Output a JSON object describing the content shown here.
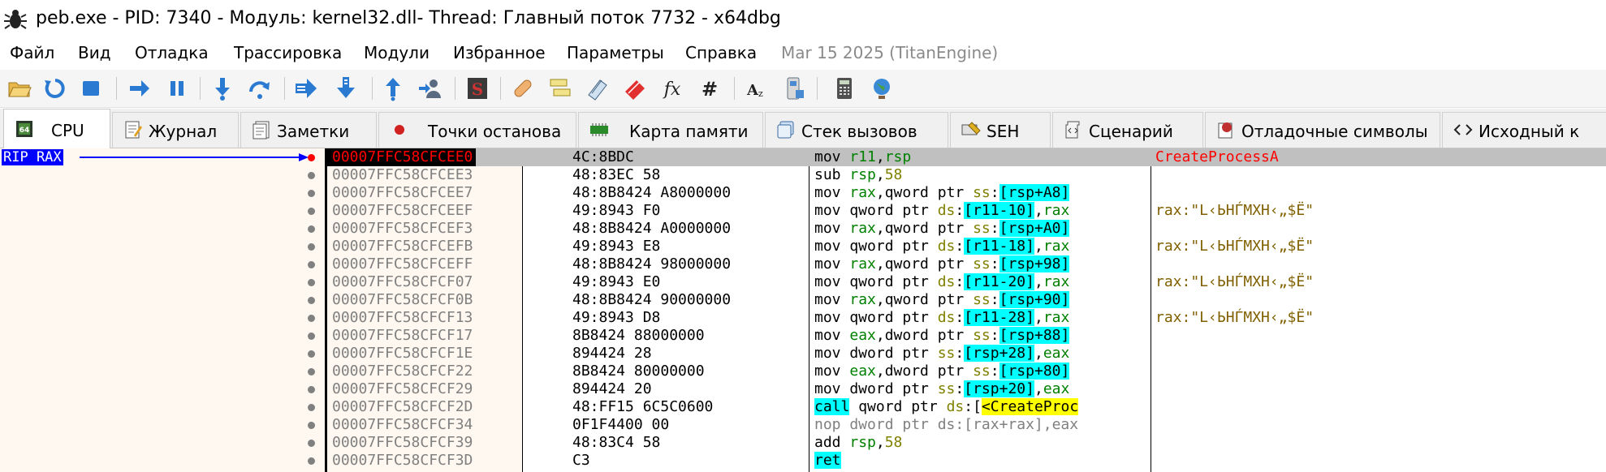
{
  "window": {
    "title": "peb.exe - PID: 7340 - Модуль: kernel32.dll- Thread: Главный поток 7732 - x64dbg"
  },
  "menu": {
    "items": [
      "Файл",
      "Вид",
      "Отладка",
      "Трассировка",
      "Модули",
      "Избранное",
      "Параметры",
      "Справка"
    ],
    "build_date": "Mar 15 2025 (TitanEngine)"
  },
  "toolbar": {
    "buttons": [
      "open-icon",
      "restart-icon",
      "stop-icon",
      "run-icon",
      "pause-icon",
      "step-into-icon",
      "step-over-icon",
      "trace-into-icon",
      "trace-over-icon",
      "execute-till-return-icon",
      "run-to-user-code-icon",
      "scylla-icon",
      "patch-icon",
      "comments-icon",
      "labels-icon",
      "bookmarks-icon",
      "functions-icon",
      "hash-icon",
      "strings-icon",
      "calculator-icon",
      "memory-icon",
      "globe-icon"
    ]
  },
  "tabs": [
    {
      "label": "CPU",
      "icon": "cpu-icon",
      "active": true
    },
    {
      "label": "Журнал",
      "icon": "log-icon"
    },
    {
      "label": "Заметки",
      "icon": "notes-icon"
    },
    {
      "label": "Точки останова",
      "icon": "breakpoint-icon"
    },
    {
      "label": "Карта памяти",
      "icon": "memory-map-icon"
    },
    {
      "label": "Стек вызовов",
      "icon": "call-stack-icon"
    },
    {
      "label": "SEH",
      "icon": "seh-icon"
    },
    {
      "label": "Сценарий",
      "icon": "script-icon"
    },
    {
      "label": "Отладочные символы",
      "icon": "symbols-icon"
    },
    {
      "label": "Исходный к",
      "icon": "source-icon"
    }
  ],
  "gutter": {
    "rip_label": "RIP RAX"
  },
  "colors": {
    "current_addr_bg": "#000000",
    "current_addr_fg": "#ff0000",
    "register": "#008000",
    "segment": "#808000",
    "bracket_hl": "#00ffff",
    "symbol_hl": "#ffff00",
    "comment": "#806000"
  },
  "disasm": {
    "rows": [
      {
        "addr": "00007FFC58CFCEE0",
        "bytes": "4C:8BDC",
        "comment": "CreateProcessA",
        "current": true
      },
      {
        "addr": "00007FFC58CFCEE3",
        "bytes": "48:83EC 58",
        "comment": ""
      },
      {
        "addr": "00007FFC58CFCEE7",
        "bytes": "48:8B8424 A8000000",
        "comment": ""
      },
      {
        "addr": "00007FFC58CFCEEF",
        "bytes": "49:8943 F0",
        "comment": "rax:\"L‹ЬНЃМХН‹„$Ё\""
      },
      {
        "addr": "00007FFC58CFCEF3",
        "bytes": "48:8B8424 A0000000",
        "comment": ""
      },
      {
        "addr": "00007FFC58CFCEFB",
        "bytes": "49:8943 E8",
        "comment": "rax:\"L‹ЬНЃМХН‹„$Ё\""
      },
      {
        "addr": "00007FFC58CFCEFF",
        "bytes": "48:8B8424 98000000",
        "comment": ""
      },
      {
        "addr": "00007FFC58CFCF07",
        "bytes": "49:8943 E0",
        "comment": "rax:\"L‹ЬНЃМХН‹„$Ё\""
      },
      {
        "addr": "00007FFC58CFCF0B",
        "bytes": "48:8B8424 90000000",
        "comment": ""
      },
      {
        "addr": "00007FFC58CFCF13",
        "bytes": "49:8943 D8",
        "comment": "rax:\"L‹ЬНЃМХН‹„$Ё\""
      },
      {
        "addr": "00007FFC58CFCF17",
        "bytes": "8B8424 88000000",
        "comment": ""
      },
      {
        "addr": "00007FFC58CFCF1E",
        "bytes": "894424 28",
        "comment": ""
      },
      {
        "addr": "00007FFC58CFCF22",
        "bytes": "8B8424 80000000",
        "comment": ""
      },
      {
        "addr": "00007FFC58CFCF29",
        "bytes": "894424 20",
        "comment": ""
      },
      {
        "addr": "00007FFC58CFCF2D",
        "bytes": "48:FF15 6C5C0600",
        "comment": ""
      },
      {
        "addr": "00007FFC58CFCF34",
        "bytes": "0F1F4400 00",
        "comment": ""
      },
      {
        "addr": "00007FFC58CFCF39",
        "bytes": "48:83C4 58",
        "comment": ""
      },
      {
        "addr": "00007FFC58CFCF3D",
        "bytes": "C3",
        "comment": ""
      }
    ],
    "instr": {
      "r0": [
        "mov ",
        "r11",
        ",",
        "rsp"
      ],
      "r1": [
        "sub ",
        "rsp",
        ",",
        "58"
      ],
      "r2": [
        "mov ",
        "rax",
        ",qword ptr ",
        "ss",
        ":",
        "[",
        "rsp+A8",
        "]"
      ],
      "r3": [
        "mov qword ptr ",
        "ds",
        ":",
        "[",
        "r11-10",
        "]",
        ",",
        "rax"
      ],
      "r4": [
        "mov ",
        "rax",
        ",qword ptr ",
        "ss",
        ":",
        "[",
        "rsp+A0",
        "]"
      ],
      "r5": [
        "mov qword ptr ",
        "ds",
        ":",
        "[",
        "r11-18",
        "]",
        ",",
        "rax"
      ],
      "r6": [
        "mov ",
        "rax",
        ",qword ptr ",
        "ss",
        ":",
        "[",
        "rsp+98",
        "]"
      ],
      "r7": [
        "mov qword ptr ",
        "ds",
        ":",
        "[",
        "r11-20",
        "]",
        ",",
        "rax"
      ],
      "r8": [
        "mov ",
        "rax",
        ",qword ptr ",
        "ss",
        ":",
        "[",
        "rsp+90",
        "]"
      ],
      "r9": [
        "mov qword ptr ",
        "ds",
        ":",
        "[",
        "r11-28",
        "]",
        ",",
        "rax"
      ],
      "r10": [
        "mov ",
        "eax",
        ",dword ptr ",
        "ss",
        ":",
        "[",
        "rsp+88",
        "]"
      ],
      "r11": [
        "mov dword ptr ",
        "ss",
        ":",
        "[",
        "rsp+28",
        "]",
        ",",
        "eax"
      ],
      "r12": [
        "mov ",
        "eax",
        ",dword ptr ",
        "ss",
        ":",
        "[",
        "rsp+80",
        "]"
      ],
      "r13": [
        "mov dword ptr ",
        "ss",
        ":",
        "[",
        "rsp+20",
        "]",
        ",",
        "eax"
      ],
      "r14": [
        "call",
        " qword ptr ",
        "ds",
        ":[",
        "<CreateProc"
      ],
      "r15": "nop dword ptr ds:[rax+rax],eax",
      "r16": [
        "add ",
        "rsp",
        ",",
        "58"
      ],
      "r17": "ret"
    }
  }
}
